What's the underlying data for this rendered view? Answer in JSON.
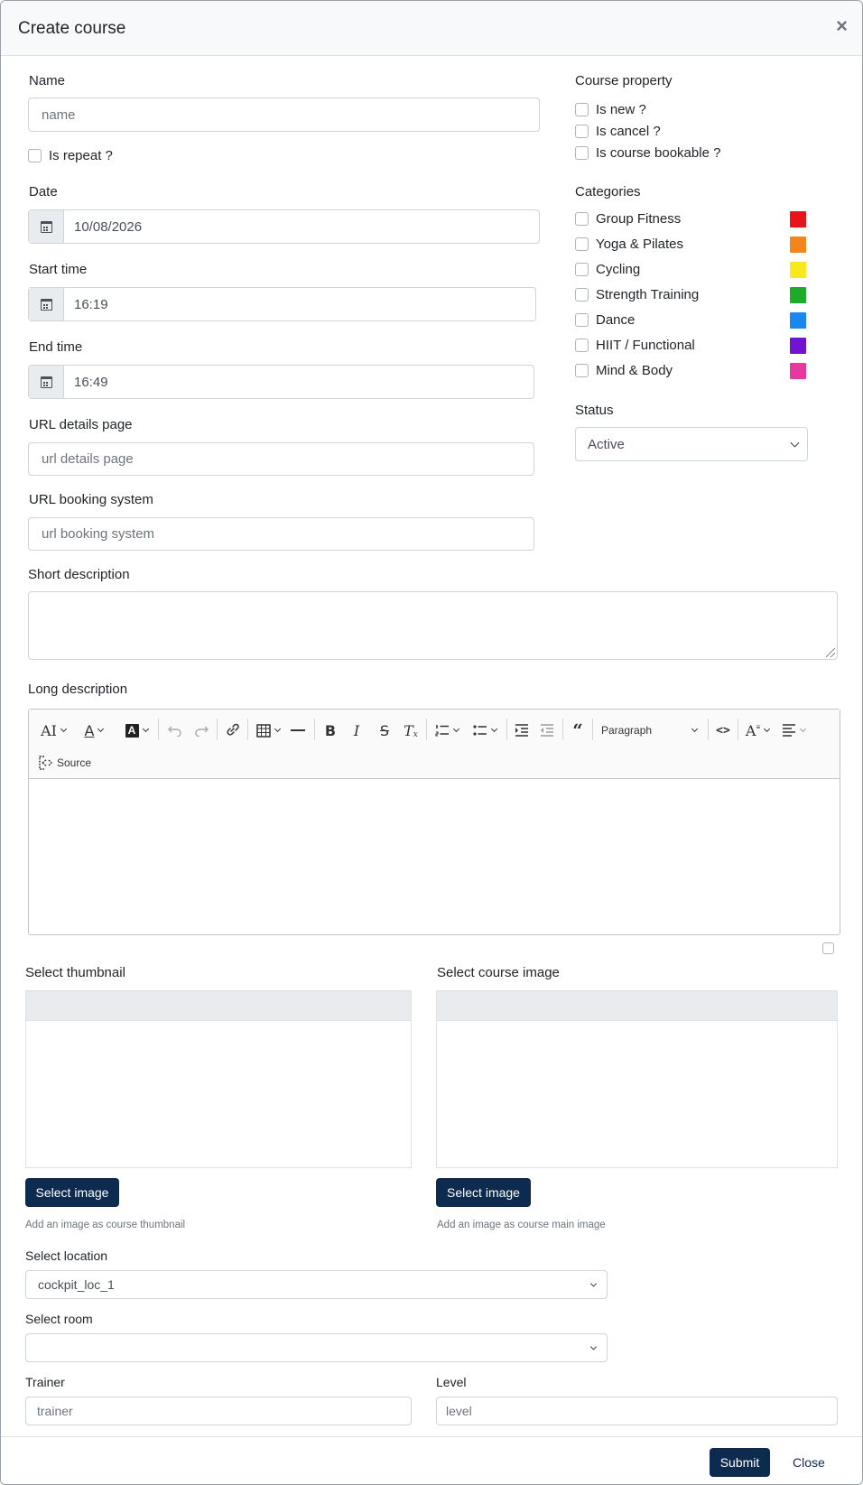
{
  "dialog": {
    "title": "Create course",
    "close_glyph": "×"
  },
  "name": {
    "label": "Name",
    "placeholder": "name",
    "repeat_label": "Is repeat ?"
  },
  "date": {
    "label": "Date",
    "value": "10/08/2026",
    "icon": "calendar-icon"
  },
  "start_time": {
    "label": "Start time",
    "value": "16:19",
    "icon": "calendar-icon"
  },
  "end_time": {
    "label": "End time",
    "value": "16:49",
    "icon": "calendar-icon"
  },
  "url_details": {
    "label": "URL details page",
    "placeholder": "url details page"
  },
  "url_booking": {
    "label": "URL booking system",
    "placeholder": "url booking system"
  },
  "course_property": {
    "label": "Course property",
    "items": [
      "Is new ?",
      "Is cancel ?",
      "Is course bookable ?"
    ]
  },
  "categories": {
    "label": "Categories",
    "items": [
      {
        "name": "Group Fitness",
        "color": "#e8141c"
      },
      {
        "name": "Yoga & Pilates",
        "color": "#f4851c"
      },
      {
        "name": "Cycling",
        "color": "#f8e81c"
      },
      {
        "name": "Strength Training",
        "color": "#1faa2a"
      },
      {
        "name": "Dance",
        "color": "#1a86f0"
      },
      {
        "name": "HIIT / Functional",
        "color": "#7213d4"
      },
      {
        "name": "Mind & Body",
        "color": "#e8389e"
      }
    ]
  },
  "status": {
    "label": "Status",
    "value": "Active"
  },
  "short_description": {
    "label": "Short description"
  },
  "long_description": {
    "label": "Long description",
    "toolbar": {
      "font_size": "AI",
      "paragraph": "Paragraph",
      "source": "Source",
      "icons": [
        "font-size-icon",
        "font-color-icon",
        "font-background-icon",
        "undo-icon",
        "redo-icon",
        "link-icon",
        "table-icon",
        "horizontal-line-icon",
        "bold-icon",
        "italic-icon",
        "strikethrough-icon",
        "remove-format-icon",
        "numbered-list-icon",
        "bulleted-list-icon",
        "indent-icon",
        "outdent-icon",
        "blockquote-icon",
        "code-icon",
        "text-style-icon",
        "align-icon",
        "source-icon"
      ]
    }
  },
  "thumbnail": {
    "label": "Select thumbnail",
    "button": "Select image",
    "help": "Add an image as course thumbnail"
  },
  "course_image": {
    "label": "Select course image",
    "button": "Select image",
    "help": "Add an image as course main image"
  },
  "location": {
    "label": "Select location",
    "value": "cockpit_loc_1"
  },
  "room": {
    "label": "Select room",
    "value": ""
  },
  "trainer": {
    "label": "Trainer",
    "placeholder": "trainer"
  },
  "level": {
    "label": "Level",
    "placeholder": "level"
  },
  "footer": {
    "submit": "Submit",
    "close": "Close"
  }
}
